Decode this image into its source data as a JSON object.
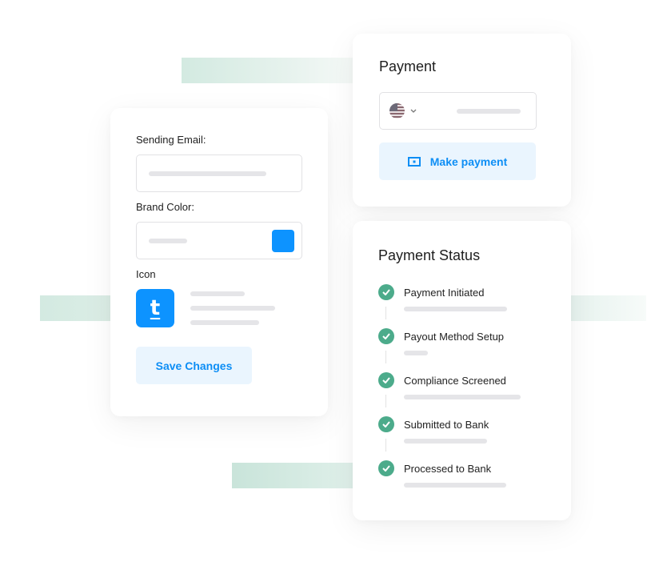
{
  "settings_card": {
    "sending_email_label": "Sending Email:",
    "brand_color_label": "Brand Color:",
    "brand_color": "#0d93ff",
    "icon_label": "Icon",
    "icon_glyph": "t",
    "save_button": "Save Changes"
  },
  "payment_card": {
    "title": "Payment",
    "country_flag": "us-flag-icon",
    "make_payment_button": "Make payment"
  },
  "status_card": {
    "title": "Payment Status",
    "steps": [
      {
        "label": "Payment Initiated",
        "status": "complete"
      },
      {
        "label": "Payout Method Setup",
        "status": "complete"
      },
      {
        "label": "Compliance Screened",
        "status": "complete"
      },
      {
        "label": "Submitted to Bank",
        "status": "complete"
      },
      {
        "label": "Processed to Bank",
        "status": "complete"
      }
    ],
    "check_color": "#4cab8b"
  },
  "colors": {
    "accent": "#0d93ff",
    "button_bg": "#eaf5fe",
    "success": "#4cab8b"
  }
}
